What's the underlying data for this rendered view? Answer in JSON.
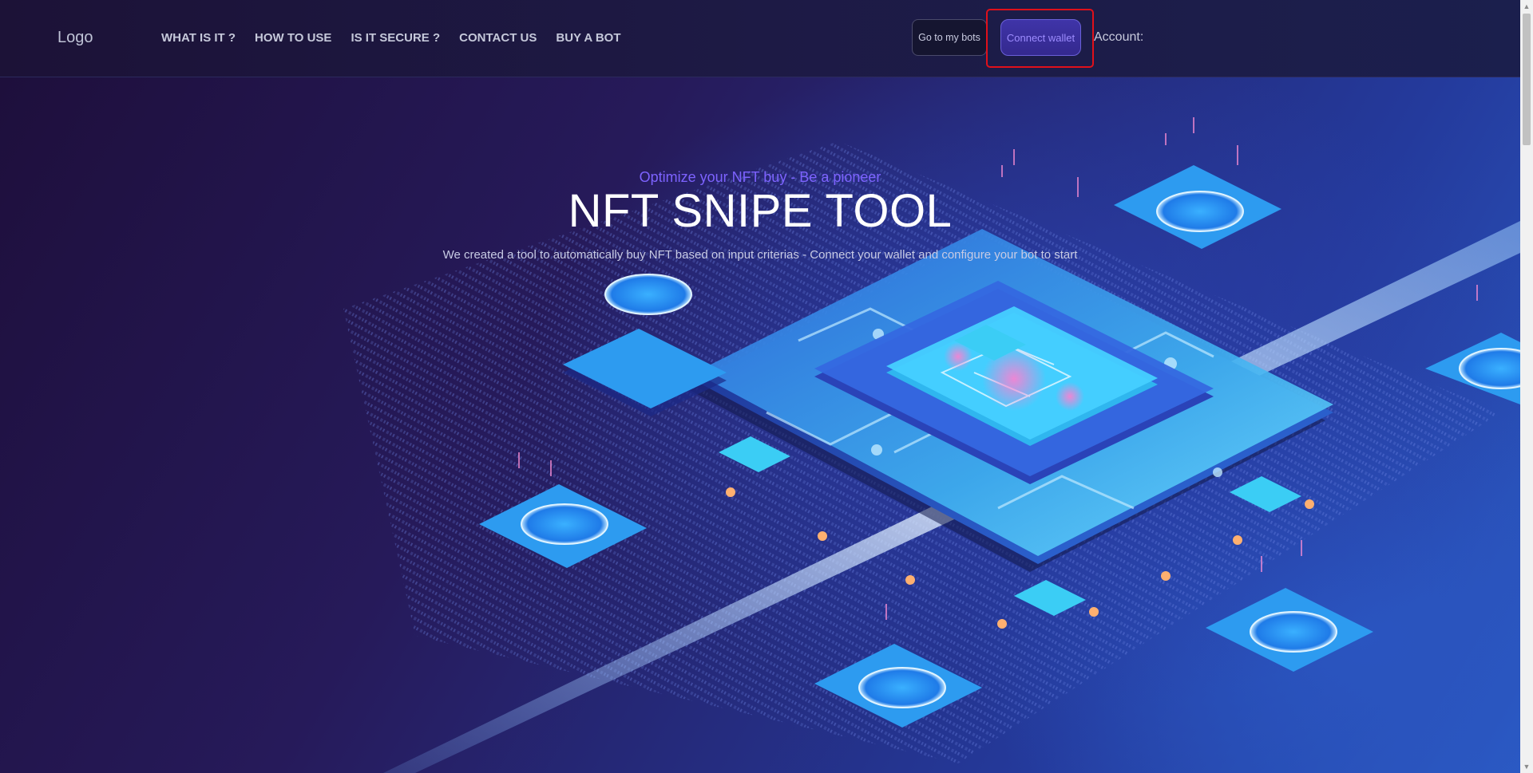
{
  "brand": {
    "logo_text": "Logo"
  },
  "nav": {
    "links": [
      "WHAT IS IT ?",
      "HOW TO USE",
      "IS IT SECURE ?",
      "CONTACT US",
      "BUY A BOT"
    ]
  },
  "header": {
    "bots_button_label": "Go to my bots",
    "connect_button_label": "Connect wallet",
    "account_label": "Account:"
  },
  "hero": {
    "tagline": "Optimize your NFT buy - Be a pioneer",
    "title": "NFT SNIPE TOOL",
    "subtitle": "We created a tool to automatically buy NFT based on input criterias - Connect your wallet and configure your bot to start"
  },
  "colors": {
    "accent": "#7d63ff",
    "highlight_outline": "#e0101a",
    "nav_background": "#1c1237"
  },
  "icons": {
    "scroll_up": "scroll-up-arrow-icon",
    "scroll_down": "scroll-down-arrow-icon"
  }
}
